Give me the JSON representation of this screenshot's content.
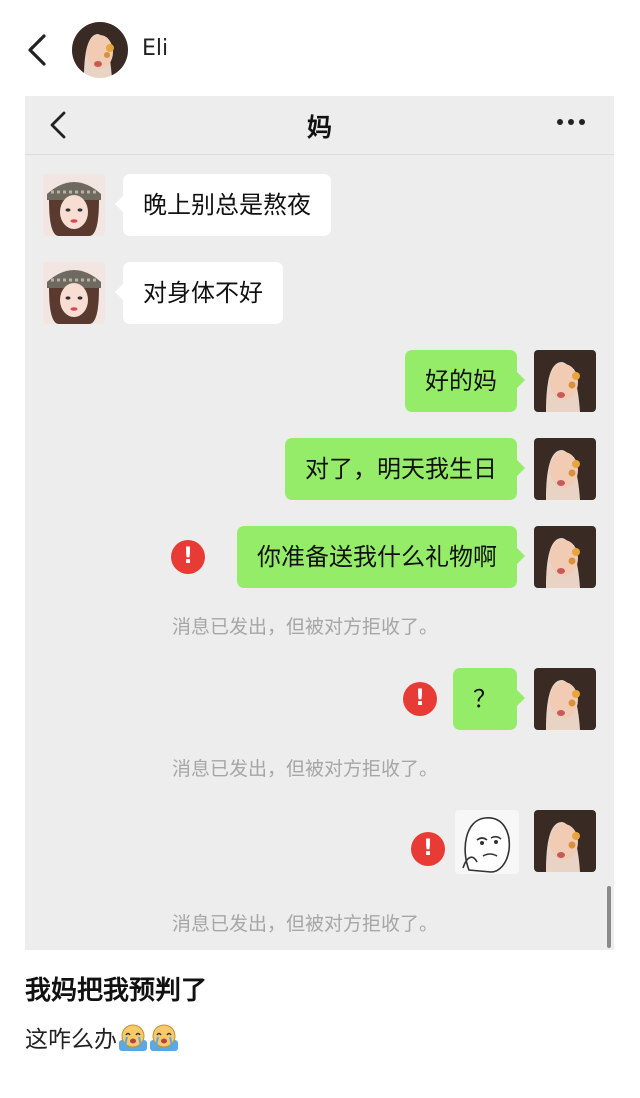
{
  "post": {
    "author": "Eli",
    "caption_title": "我妈把我预判了",
    "caption_body": "这咋么办",
    "caption_emoji": [
      "crying-face-emoji",
      "crying-face-emoji"
    ]
  },
  "chat": {
    "title": "妈",
    "messages": [
      {
        "from": "other",
        "text": "晚上别总是熬夜"
      },
      {
        "from": "other",
        "text": "对身体不好"
      },
      {
        "from": "self",
        "text": "好的妈"
      },
      {
        "from": "self",
        "text": "对了，明天我生日"
      },
      {
        "from": "self",
        "text": "你准备送我什么礼物啊",
        "error": true,
        "notice": "消息已发出，但被对方拒收了。"
      },
      {
        "from": "self",
        "text": "？",
        "error": true,
        "notice": "消息已发出，但被对方拒收了。"
      },
      {
        "from": "self",
        "sticker": "meme-face-sticker",
        "error": true,
        "notice": "消息已发出，但被对方拒收了。"
      }
    ]
  },
  "colors": {
    "green_bubble": "#95ec69",
    "error_red": "#e83b35",
    "chat_bg": "#ededed"
  }
}
